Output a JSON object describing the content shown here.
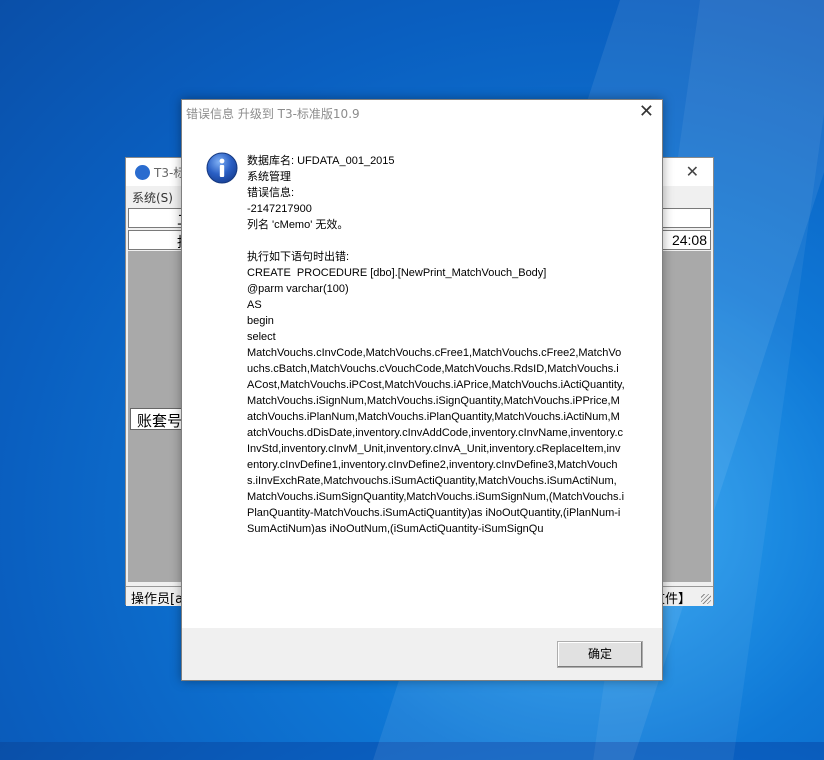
{
  "background_window": {
    "title": "T3-标",
    "menu_system": "系统(S)",
    "header_row1": "二",
    "header_row2": "拐",
    "time": "24:08",
    "account_label": "账套号",
    "status_left": "操作员[a",
    "status_right": "文件】"
  },
  "dialog": {
    "title": "错误信息  升级到 T3-标准版10.9",
    "close_glyph": "✕",
    "icon": "info-icon",
    "message_header": [
      "数据库名: UFDATA_001_2015",
      "系统管理",
      "错误信息:",
      "-2147217900",
      "列名 'cMemo' 无效。",
      "",
      "执行如下语句时出错:",
      "CREATE  PROCEDURE [dbo].[NewPrint_MatchVouch_Body]",
      "@parm varchar(100)",
      "AS",
      "begin",
      "select"
    ],
    "message_sql": "MatchVouchs.cInvCode,MatchVouchs.cFree1,MatchVouchs.cFree2,MatchVouchs.cBatch,MatchVouchs.cVouchCode,MatchVouchs.RdsID,MatchVouchs.iACost,MatchVouchs.iPCost,MatchVouchs.iAPrice,MatchVouchs.iActiQuantity,MatchVouchs.iSignNum,MatchVouchs.iSignQuantity,MatchVouchs.iPPrice,MatchVouchs.iPlanNum,MatchVouchs.iPlanQuantity,MatchVouchs.iActiNum,MatchVouchs.dDisDate,inventory.cInvAddCode,inventory.cInvName,inventory.cInvStd,inventory.cInvM_Unit,inventory.cInvA_Unit,inventory.cReplaceItem,inventory.cInvDefine1,inventory.cInvDefine2,inventory.cInvDefine3,MatchVouchs.iInvExchRate,Matchvouchs.iSumActiQuantity,MatchVouchs.iSumActiNum,MatchVouchs.iSumSignQuantity,MatchVouchs.iSumSignNum,(MatchVouchs.iPlanQuantity-MatchVouchs.iSumActiQuantity)as iNoOutQuantity,(iPlanNum-iSumActiNum)as iNoOutNum,(iSumActiQuantity-iSumSignQu",
    "ok_label": "确定"
  },
  "colors": {
    "desktop": "#0f78d6",
    "dialog_bg": "#ffffff",
    "footer_bg": "#f0f0f0",
    "info_icon": "#2a5fc4"
  }
}
